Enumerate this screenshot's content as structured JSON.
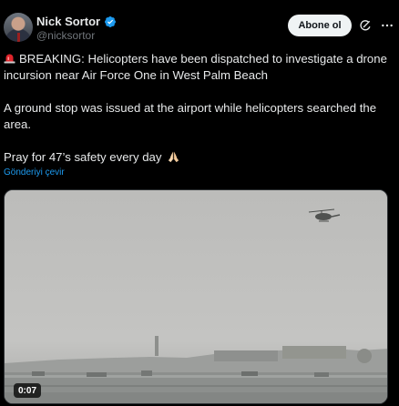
{
  "author": {
    "display_name": "Nick Sortor",
    "handle": "@nicksortor",
    "verified": true,
    "verified_color": "#1d9bf0"
  },
  "actions": {
    "follow_label": "Abone ol",
    "grok_icon": "grok-icon",
    "more_icon": "more-icon"
  },
  "tweet": {
    "paragraph_1": "BREAKING: Helicopters have been dispatched to investigate a drone incursion near Air Force One in West Palm Beach",
    "paragraph_2": "A ground stop was issued at the airport while helicopters searched the area.",
    "paragraph_3": "Pray for 47’s safety every day",
    "leading_emoji": "siren-icon",
    "trailing_emoji": "pray-icon"
  },
  "translate_label": "Gönderiyi çevir",
  "media": {
    "type": "video",
    "duration": "0:07"
  },
  "colors": {
    "background": "#000000",
    "text": "#e7e9ea",
    "secondary_text": "#71767b",
    "link": "#1d9bf0",
    "follow_button_bg": "#eff3f4"
  }
}
